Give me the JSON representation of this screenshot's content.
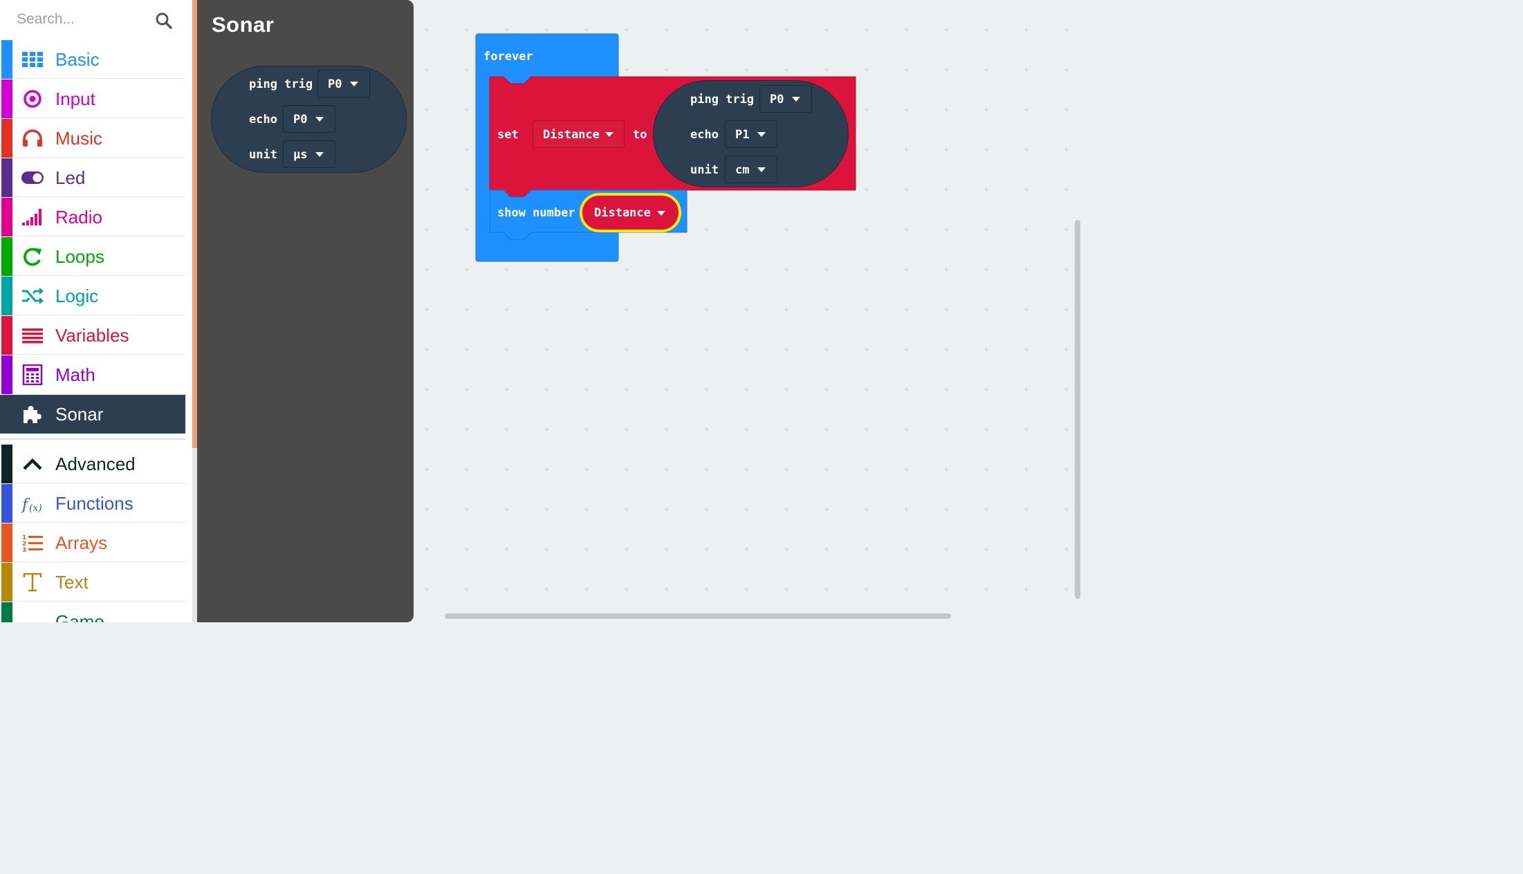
{
  "toolbox": {
    "search_placeholder": "Search...",
    "categories": [
      {
        "label": "Basic",
        "color": "#1e90ff",
        "icon": "grid-icon"
      },
      {
        "label": "Input",
        "color": "#d400d4",
        "icon": "target-icon"
      },
      {
        "label": "Music",
        "color": "#e63022",
        "icon": "headphones-icon"
      },
      {
        "label": "Led",
        "color": "#5c2d91",
        "icon": "toggle-icon"
      },
      {
        "label": "Radio",
        "color": "#e3008c",
        "icon": "signal-bars-icon"
      },
      {
        "label": "Loops",
        "color": "#00aa00",
        "icon": "refresh-icon"
      },
      {
        "label": "Logic",
        "color": "#00a4a6",
        "icon": "shuffle-icon"
      },
      {
        "label": "Variables",
        "color": "#dc143c",
        "icon": "list-lines-icon"
      },
      {
        "label": "Math",
        "color": "#9400d3",
        "icon": "calculator-icon"
      },
      {
        "label": "Sonar",
        "color": "#2c3e50",
        "icon": "puzzle-icon"
      },
      {
        "label": "Advanced",
        "color": "#0d2526",
        "icon": "chevron-up-icon"
      },
      {
        "label": "Functions",
        "color": "#3455db",
        "icon": "function-icon"
      },
      {
        "label": "Arrays",
        "color": "#e65722",
        "icon": "numbered-list-icon"
      },
      {
        "label": "Text",
        "color": "#b8860b",
        "icon": "text-t-icon"
      },
      {
        "label": "Game",
        "color": "#007a4b",
        "icon": "gamepad-icon"
      }
    ]
  },
  "flyout": {
    "title": "Sonar",
    "block": {
      "ping_label": "ping trig",
      "trig_value": "P0",
      "echo_label": "echo",
      "echo_value": "P0",
      "unit_label": "unit",
      "unit_value": "μs"
    }
  },
  "workspace": {
    "forever_label": "forever",
    "set_label": "set",
    "set_variable": "Distance",
    "to_label": "to",
    "ping": {
      "ping_label": "ping trig",
      "trig_value": "P0",
      "echo_label": "echo",
      "echo_value": "P1",
      "unit_label": "unit",
      "unit_value": "cm"
    },
    "show_number_label": "show number",
    "show_variable": "Distance"
  },
  "colors": {
    "basic": "#1e90ff",
    "variables": "#dc143c",
    "sonar": "#2c3e50",
    "highlight": "#ffeb00"
  }
}
